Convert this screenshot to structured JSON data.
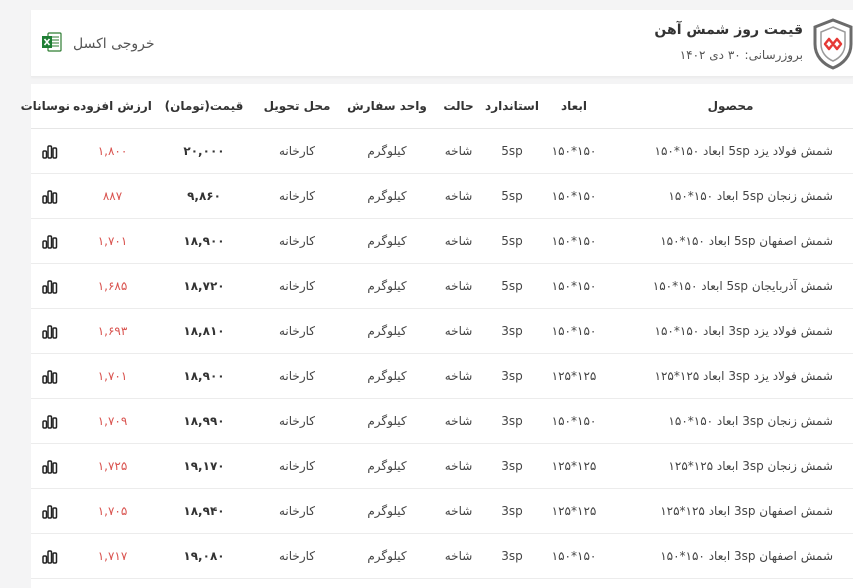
{
  "header": {
    "title": "قیمت روز شمش آهن",
    "updated": "بروزرسانی: ۳۰ دی ۱۴۰۲",
    "excel_label": "خروجی اکسل",
    "logo_icon": "shield-logo-icon",
    "excel_icon": "excel-icon",
    "accent_color": "#e53935"
  },
  "table": {
    "columns": {
      "product": "محصول",
      "size": "ابعاد",
      "standard": "استاندارد",
      "state": "حالت",
      "unit": "واحد سفارش",
      "delivery": "محل تحویل",
      "price": "قیمت(تومان)",
      "added": "ارزش افزوده",
      "chart": "نوسانات"
    },
    "chart_icon": "bar-chart-icon",
    "rows": [
      {
        "product": "شمش فولاد یزد 5sp ابعاد ۱۵۰*۱۵۰",
        "size": "۱۵۰*۱۵۰",
        "standard": "5sp",
        "state": "شاخه",
        "unit": "کیلوگرم",
        "delivery": "کارخانه",
        "price": "۲۰,۰۰۰",
        "added": "۱,۸۰۰"
      },
      {
        "product": "شمش زنجان 5sp ابعاد ۱۵۰*۱۵۰",
        "size": "۱۵۰*۱۵۰",
        "standard": "5sp",
        "state": "شاخه",
        "unit": "کیلوگرم",
        "delivery": "کارخانه",
        "price": "۹,۸۶۰",
        "added": "۸۸۷"
      },
      {
        "product": "شمش اصفهان 5sp ابعاد ۱۵۰*۱۵۰",
        "size": "۱۵۰*۱۵۰",
        "standard": "5sp",
        "state": "شاخه",
        "unit": "کیلوگرم",
        "delivery": "کارخانه",
        "price": "۱۸,۹۰۰",
        "added": "۱,۷۰۱"
      },
      {
        "product": "شمش آذربایجان 5sp ابعاد ۱۵۰*۱۵۰",
        "size": "۱۵۰*۱۵۰",
        "standard": "5sp",
        "state": "شاخه",
        "unit": "کیلوگرم",
        "delivery": "کارخانه",
        "price": "۱۸,۷۲۰",
        "added": "۱,۶۸۵"
      },
      {
        "product": "شمش فولاد یزد 3sp ابعاد ۱۵۰*۱۵۰",
        "size": "۱۵۰*۱۵۰",
        "standard": "3sp",
        "state": "شاخه",
        "unit": "کیلوگرم",
        "delivery": "کارخانه",
        "price": "۱۸,۸۱۰",
        "added": "۱,۶۹۳"
      },
      {
        "product": "شمش فولاد یزد 3sp ابعاد ۱۲۵*۱۲۵",
        "size": "۱۲۵*۱۲۵",
        "standard": "3sp",
        "state": "شاخه",
        "unit": "کیلوگرم",
        "delivery": "کارخانه",
        "price": "۱۸,۹۰۰",
        "added": "۱,۷۰۱"
      },
      {
        "product": "شمش زنجان 3sp ابعاد ۱۵۰*۱۵۰",
        "size": "۱۵۰*۱۵۰",
        "standard": "3sp",
        "state": "شاخه",
        "unit": "کیلوگرم",
        "delivery": "کارخانه",
        "price": "۱۸,۹۹۰",
        "added": "۱,۷۰۹"
      },
      {
        "product": "شمش زنجان 3sp ابعاد ۱۲۵*۱۲۵",
        "size": "۱۲۵*۱۲۵",
        "standard": "3sp",
        "state": "شاخه",
        "unit": "کیلوگرم",
        "delivery": "کارخانه",
        "price": "۱۹,۱۷۰",
        "added": "۱,۷۲۵"
      },
      {
        "product": "شمش اصفهان 3sp ابعاد ۱۲۵*۱۲۵",
        "size": "۱۲۵*۱۲۵",
        "standard": "3sp",
        "state": "شاخه",
        "unit": "کیلوگرم",
        "delivery": "کارخانه",
        "price": "۱۸,۹۴۰",
        "added": "۱,۷۰۵"
      },
      {
        "product": "شمش اصفهان 3sp ابعاد ۱۵۰*۱۵۰",
        "size": "۱۵۰*۱۵۰",
        "standard": "3sp",
        "state": "شاخه",
        "unit": "کیلوگرم",
        "delivery": "کارخانه",
        "price": "۱۹,۰۸۰",
        "added": "۱,۷۱۷"
      }
    ]
  }
}
